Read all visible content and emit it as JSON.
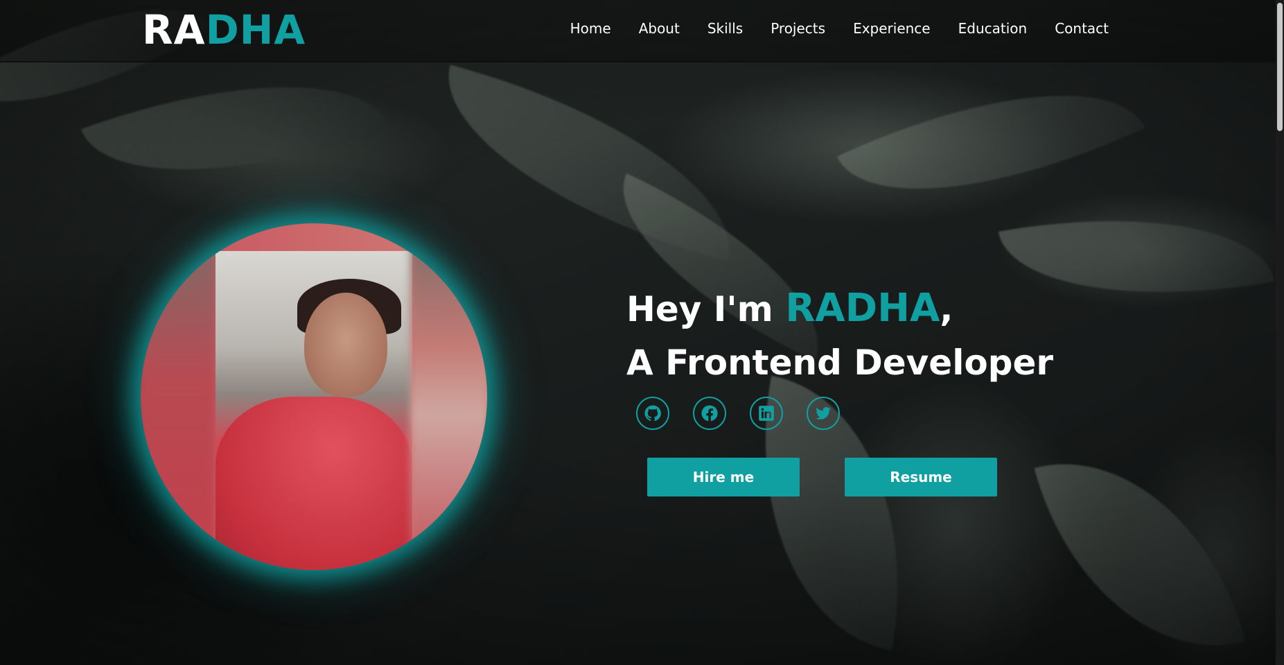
{
  "logo": {
    "part1": "RA",
    "part2": "DHA"
  },
  "nav": {
    "items": [
      "Home",
      "About",
      "Skills",
      "Projects",
      "Experience",
      "Education",
      "Contact"
    ]
  },
  "hero": {
    "greeting": "Hey I'm ",
    "name": "RADHA",
    "comma": ",",
    "role": "A Frontend Developer",
    "hire_label": "Hire me",
    "resume_label": "Resume"
  },
  "socials": [
    "github-icon",
    "facebook-icon",
    "linkedin-icon",
    "twitter-icon"
  ],
  "colors": {
    "accent": "#11a0a1",
    "text": "#ffffff"
  }
}
